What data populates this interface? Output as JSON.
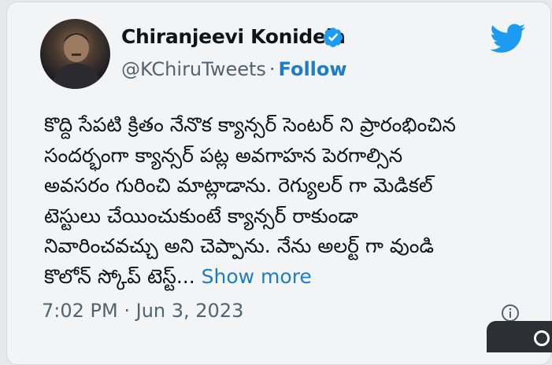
{
  "tweet": {
    "author": {
      "name": "Chiranjeevi Konidela",
      "handle": "@KChiruTweets",
      "separator": "·",
      "follow_label": "Follow",
      "verified_icon": "verified-badge-icon",
      "avatar_icon": "profile-photo"
    },
    "logo_icon": "twitter-bird-icon",
    "body_lines": [
      "కొద్ది సేపటి క్రితం  నేనొక క్యాన్సర్ సెంటర్ ని  ప్రారంభించిన",
      "సందర్భంగా క్యాన్సర్ పట్ల  అవగాహన పెరగాల్సిన",
      "అవసరం  గురించి  మాట్లాడాను. రెగ్యులర్ గా మెడికల్",
      "టెస్టులు   చేయించుకుంటే  క్యాన్సర్ రాకుండా",
      "నివారించవచ్చు అని చెప్పాను. నేను  అలర్ట్  గా  వుండి",
      "కొలోన్ స్కోప్  టెస్ట్..."
    ],
    "show_more_label": "Show more",
    "time": "7:02 PM",
    "meta_separator": "·",
    "date": "Jun 3, 2023",
    "info_icon": "info-icon"
  },
  "colors": {
    "link": "#1d7ec8",
    "verified": "#1d9bf0",
    "twitter_blue": "#1d9bf0",
    "muted": "#536471",
    "text": "#0f1419"
  }
}
